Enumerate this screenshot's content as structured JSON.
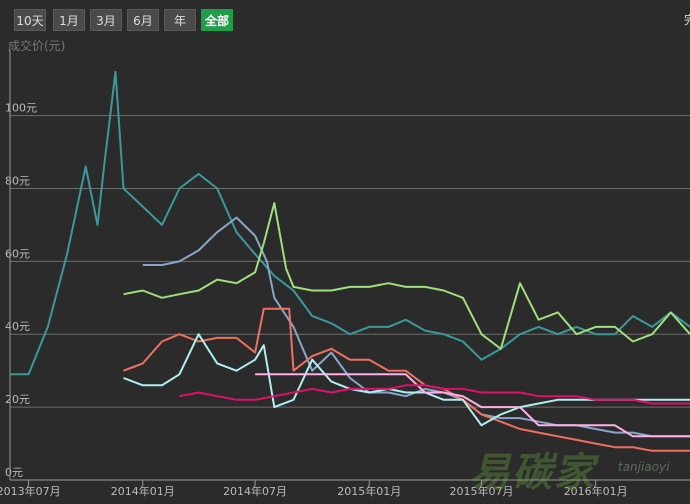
{
  "toolbar": {
    "buttons": [
      {
        "label": "10天",
        "active": false
      },
      {
        "label": "1月",
        "active": false
      },
      {
        "label": "3月",
        "active": false
      },
      {
        "label": "6月",
        "active": false
      },
      {
        "label": "年",
        "active": false
      },
      {
        "label": "全部",
        "active": true
      }
    ],
    "corner_text": "完"
  },
  "watermark": {
    "main": "易碳家",
    "sub": "tanjiaoyi"
  },
  "colors": {
    "background": "#2b2b2b",
    "active_button": "#1e9e49",
    "grid": "#777777"
  },
  "chart_data": {
    "type": "line",
    "ylabel": "成交价(元)",
    "y_ticks": [
      0,
      20,
      40,
      60,
      80,
      100
    ],
    "y_tick_labels": [
      "0元",
      "20元",
      "40元",
      "60元",
      "80元",
      "100元"
    ],
    "ylim": [
      0,
      118
    ],
    "x_ticks": [
      "2013-07",
      "2014-01",
      "2014-07",
      "2015-01",
      "2015-07",
      "2016-01"
    ],
    "x_tick_labels": [
      "2013年07月",
      "2014年01月",
      "2014年07月",
      "2015年01月",
      "2015年07月",
      "2016年01月"
    ],
    "xlim": [
      "2013-06",
      "2016-06"
    ],
    "grid": true,
    "series": [
      {
        "color": "#3a9a9a",
        "points": [
          [
            "2013-06",
            29
          ],
          [
            "2013-07",
            29
          ],
          [
            "2013-08",
            42
          ],
          [
            "2013-09",
            62
          ],
          [
            "2013-10",
            86
          ],
          [
            "2013-10-20",
            70
          ],
          [
            "2013-11",
            88
          ],
          [
            "2013-11-18",
            112
          ],
          [
            "2013-12",
            80
          ],
          [
            "2014-01",
            75
          ],
          [
            "2014-02",
            70
          ],
          [
            "2014-03",
            80
          ],
          [
            "2014-04",
            84
          ],
          [
            "2014-05",
            80
          ],
          [
            "2014-06",
            68
          ],
          [
            "2014-07",
            62
          ],
          [
            "2014-08",
            56
          ],
          [
            "2014-09",
            52
          ],
          [
            "2014-10",
            45
          ],
          [
            "2014-11",
            43
          ],
          [
            "2014-12",
            40
          ],
          [
            "2015-01",
            42
          ],
          [
            "2015-02",
            42
          ],
          [
            "2015-03",
            44
          ],
          [
            "2015-04",
            41
          ],
          [
            "2015-05",
            40
          ],
          [
            "2015-06",
            38
          ],
          [
            "2015-07",
            33
          ],
          [
            "2015-08",
            36
          ],
          [
            "2015-09",
            40
          ],
          [
            "2015-10",
            42
          ],
          [
            "2015-11",
            40
          ],
          [
            "2015-12",
            42
          ],
          [
            "2016-01",
            40
          ],
          [
            "2016-02",
            40
          ],
          [
            "2016-03",
            45
          ],
          [
            "2016-04",
            42
          ],
          [
            "2016-05",
            46
          ],
          [
            "2016-06",
            42
          ]
        ]
      },
      {
        "color": "#88a6c8",
        "points": [
          [
            "2014-01",
            59
          ],
          [
            "2014-02",
            59
          ],
          [
            "2014-03",
            60
          ],
          [
            "2014-04",
            63
          ],
          [
            "2014-05",
            68
          ],
          [
            "2014-06",
            72
          ],
          [
            "2014-07",
            67
          ],
          [
            "2014-07-20",
            60
          ],
          [
            "2014-08",
            50
          ],
          [
            "2014-09",
            42
          ],
          [
            "2014-10",
            30
          ],
          [
            "2014-11",
            35
          ],
          [
            "2014-12",
            28
          ],
          [
            "2015-01",
            24
          ],
          [
            "2015-02",
            24
          ],
          [
            "2015-03",
            23
          ],
          [
            "2015-04",
            25
          ],
          [
            "2015-05",
            24
          ],
          [
            "2015-06",
            22
          ],
          [
            "2015-07",
            18
          ],
          [
            "2015-08",
            17
          ],
          [
            "2015-09",
            17
          ],
          [
            "2015-10",
            16
          ],
          [
            "2015-11",
            15
          ],
          [
            "2015-12",
            15
          ],
          [
            "2016-01",
            14
          ],
          [
            "2016-02",
            13
          ],
          [
            "2016-03",
            13
          ],
          [
            "2016-04",
            12
          ],
          [
            "2016-05",
            12
          ],
          [
            "2016-06",
            12
          ]
        ]
      },
      {
        "color": "#9ee07a",
        "points": [
          [
            "2013-12",
            51
          ],
          [
            "2014-01",
            52
          ],
          [
            "2014-02",
            50
          ],
          [
            "2014-03",
            51
          ],
          [
            "2014-04",
            52
          ],
          [
            "2014-05",
            55
          ],
          [
            "2014-06",
            54
          ],
          [
            "2014-07",
            57
          ],
          [
            "2014-07-15",
            65
          ],
          [
            "2014-08",
            76
          ],
          [
            "2014-08-20",
            58
          ],
          [
            "2014-09",
            53
          ],
          [
            "2014-10",
            52
          ],
          [
            "2014-11",
            52
          ],
          [
            "2014-12",
            53
          ],
          [
            "2015-01",
            53
          ],
          [
            "2015-02",
            54
          ],
          [
            "2015-03",
            53
          ],
          [
            "2015-04",
            53
          ],
          [
            "2015-05",
            52
          ],
          [
            "2015-06",
            50
          ],
          [
            "2015-07",
            40
          ],
          [
            "2015-08",
            36
          ],
          [
            "2015-09",
            54
          ],
          [
            "2015-10",
            44
          ],
          [
            "2015-11",
            46
          ],
          [
            "2015-12",
            40
          ],
          [
            "2016-01",
            42
          ],
          [
            "2016-02",
            42
          ],
          [
            "2016-03",
            38
          ],
          [
            "2016-04",
            40
          ],
          [
            "2016-05",
            46
          ],
          [
            "2016-06",
            40
          ]
        ]
      },
      {
        "color": "#f07060",
        "points": [
          [
            "2013-12",
            30
          ],
          [
            "2014-01",
            32
          ],
          [
            "2014-02",
            38
          ],
          [
            "2014-03",
            40
          ],
          [
            "2014-04",
            38
          ],
          [
            "2014-05",
            39
          ],
          [
            "2014-06",
            39
          ],
          [
            "2014-07",
            35
          ],
          [
            "2014-07-15",
            47
          ],
          [
            "2014-08",
            47
          ],
          [
            "2014-08-25",
            47
          ],
          [
            "2014-09",
            30
          ],
          [
            "2014-10",
            34
          ],
          [
            "2014-11",
            36
          ],
          [
            "2014-12",
            33
          ],
          [
            "2015-01",
            33
          ],
          [
            "2015-02",
            30
          ],
          [
            "2015-03",
            30
          ],
          [
            "2015-04",
            26
          ],
          [
            "2015-05",
            25
          ],
          [
            "2015-06",
            22
          ],
          [
            "2015-07",
            18
          ],
          [
            "2015-08",
            16
          ],
          [
            "2015-09",
            14
          ],
          [
            "2015-10",
            13
          ],
          [
            "2015-11",
            12
          ],
          [
            "2015-12",
            11
          ],
          [
            "2016-01",
            10
          ],
          [
            "2016-02",
            9
          ],
          [
            "2016-03",
            9
          ],
          [
            "2016-04",
            8
          ],
          [
            "2016-05",
            8
          ],
          [
            "2016-06",
            8
          ]
        ]
      },
      {
        "color": "#aef0f0",
        "points": [
          [
            "2013-12",
            28
          ],
          [
            "2014-01",
            26
          ],
          [
            "2014-02",
            26
          ],
          [
            "2014-03",
            29
          ],
          [
            "2014-04",
            40
          ],
          [
            "2014-05",
            32
          ],
          [
            "2014-06",
            30
          ],
          [
            "2014-07",
            33
          ],
          [
            "2014-07-15",
            37
          ],
          [
            "2014-08",
            20
          ],
          [
            "2014-09",
            22
          ],
          [
            "2014-10",
            33
          ],
          [
            "2014-11",
            27
          ],
          [
            "2014-12",
            25
          ],
          [
            "2015-01",
            24
          ],
          [
            "2015-02",
            25
          ],
          [
            "2015-03",
            24
          ],
          [
            "2015-04",
            24
          ],
          [
            "2015-05",
            22
          ],
          [
            "2015-06",
            22
          ],
          [
            "2015-07",
            15
          ],
          [
            "2015-08",
            18
          ],
          [
            "2015-09",
            20
          ],
          [
            "2015-10",
            21
          ],
          [
            "2015-11",
            22
          ],
          [
            "2015-12",
            22
          ],
          [
            "2016-01",
            22
          ],
          [
            "2016-02",
            22
          ],
          [
            "2016-03",
            22
          ],
          [
            "2016-04",
            22
          ],
          [
            "2016-05",
            22
          ],
          [
            "2016-06",
            22
          ]
        ]
      },
      {
        "color": "#ffb0e8",
        "points": [
          [
            "2014-07",
            29
          ],
          [
            "2014-08",
            29
          ],
          [
            "2014-09",
            29
          ],
          [
            "2014-10",
            29
          ],
          [
            "2014-11",
            29
          ],
          [
            "2014-12",
            29
          ],
          [
            "2015-01",
            29
          ],
          [
            "2015-02",
            29
          ],
          [
            "2015-03",
            29
          ],
          [
            "2015-04",
            24
          ],
          [
            "2015-05",
            24
          ],
          [
            "2015-06",
            23
          ],
          [
            "2015-07",
            20
          ],
          [
            "2015-08",
            20
          ],
          [
            "2015-09",
            20
          ],
          [
            "2015-10",
            15
          ],
          [
            "2015-11",
            15
          ],
          [
            "2015-12",
            15
          ],
          [
            "2016-01",
            15
          ],
          [
            "2016-02",
            15
          ],
          [
            "2016-03",
            12
          ],
          [
            "2016-04",
            12
          ],
          [
            "2016-05",
            12
          ],
          [
            "2016-06",
            12
          ]
        ]
      },
      {
        "color": "#e0106a",
        "points": [
          [
            "2014-03",
            23
          ],
          [
            "2014-04",
            24
          ],
          [
            "2014-05",
            23
          ],
          [
            "2014-06",
            22
          ],
          [
            "2014-07",
            22
          ],
          [
            "2014-08",
            23
          ],
          [
            "2014-09",
            24
          ],
          [
            "2014-10",
            25
          ],
          [
            "2014-11",
            24
          ],
          [
            "2014-12",
            25
          ],
          [
            "2015-01",
            25
          ],
          [
            "2015-02",
            25
          ],
          [
            "2015-03",
            26
          ],
          [
            "2015-04",
            26
          ],
          [
            "2015-05",
            25
          ],
          [
            "2015-06",
            25
          ],
          [
            "2015-07",
            24
          ],
          [
            "2015-08",
            24
          ],
          [
            "2015-09",
            24
          ],
          [
            "2015-10",
            23
          ],
          [
            "2015-11",
            23
          ],
          [
            "2015-12",
            23
          ],
          [
            "2016-01",
            22
          ],
          [
            "2016-02",
            22
          ],
          [
            "2016-03",
            22
          ],
          [
            "2016-04",
            21
          ],
          [
            "2016-05",
            21
          ],
          [
            "2016-06",
            21
          ]
        ]
      }
    ]
  }
}
